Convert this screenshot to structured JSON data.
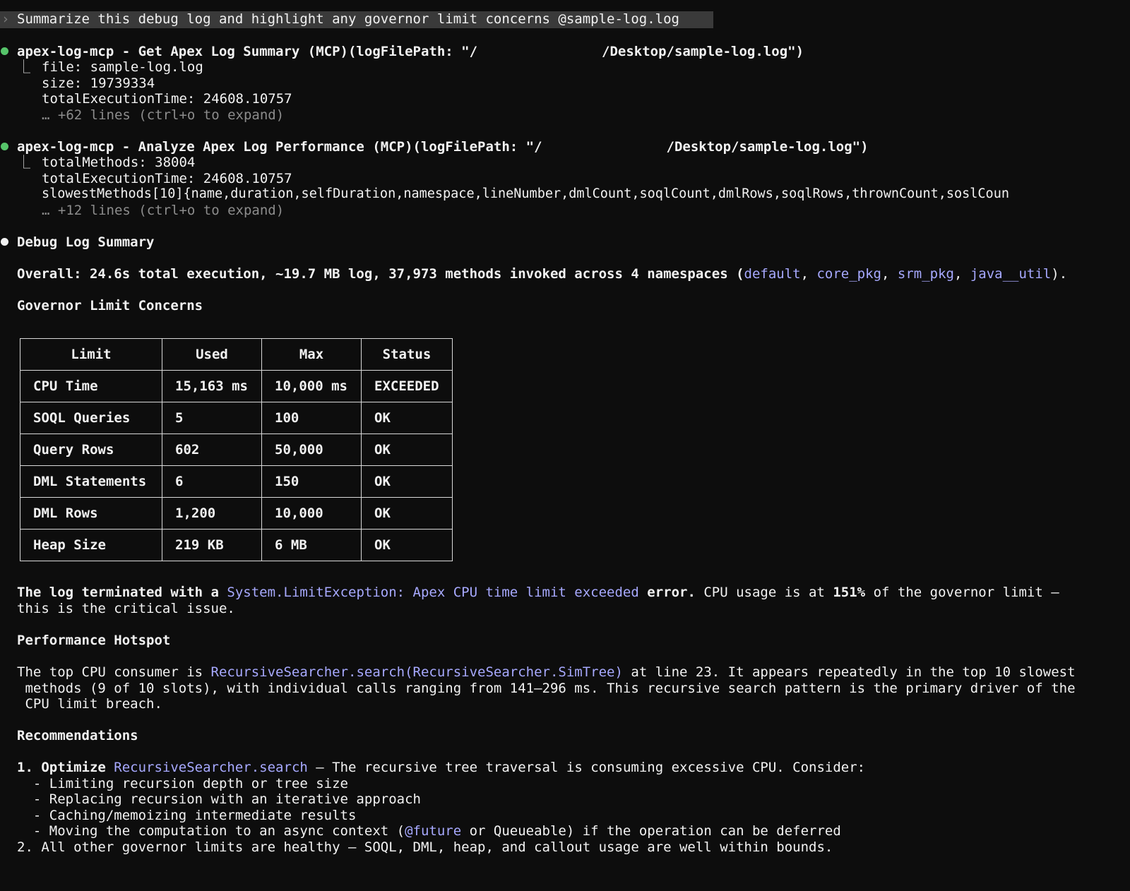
{
  "prompt": {
    "caret": "›",
    "text": "Summarize this debug log and highlight any governor limit concerns @sample-log.log"
  },
  "tool_calls": [
    {
      "header_prefix": "apex-log-mcp - Get Apex Log Summary (MCP)(logFilePath: \"/",
      "header_suffix": "/Desktop/sample-log.log\")",
      "lines": [
        "file: sample-log.log",
        "size: 19739334",
        "totalExecutionTime: 24608.10757"
      ],
      "expand": "… +62 lines (ctrl+o to expand)"
    },
    {
      "header_prefix": "apex-log-mcp - Analyze Apex Log Performance (MCP)(logFilePath: \"/",
      "header_suffix": "/Desktop/sample-log.log\")",
      "lines": [
        "totalMethods: 38004",
        "totalExecutionTime: 24608.10757",
        "slowestMethods[10]{name,duration,selfDuration,namespace,lineNumber,dmlCount,soqlCount,dmlRows,soqlRows,thrownCount,soslCoun"
      ],
      "expand": "… +12 lines (ctrl+o to expand)"
    }
  ],
  "summary": {
    "title": "Debug Log Summary",
    "overall_prefix": "Overall: 24.6s total execution, ~19.7 MB log, 37,973 methods invoked across 4 namespaces (",
    "namespaces": [
      "default",
      "core_pkg",
      "srm_pkg",
      "java__util"
    ],
    "overall_suffix": ").",
    "governor_heading": "Governor Limit Concerns",
    "table": {
      "headers": [
        "Limit",
        "Used",
        "Max",
        "Status"
      ],
      "rows": [
        [
          "CPU Time",
          "15,163 ms",
          "10,000 ms",
          "EXCEEDED"
        ],
        [
          "SOQL Queries",
          "5",
          "100",
          "OK"
        ],
        [
          "Query Rows",
          "602",
          "50,000",
          "OK"
        ],
        [
          "DML Statements",
          "6",
          "150",
          "OK"
        ],
        [
          "DML Rows",
          "1,200",
          "10,000",
          "OK"
        ],
        [
          "Heap Size",
          "219 KB",
          "6 MB",
          "OK"
        ]
      ]
    },
    "terminated_prefix": "The log terminated with a ",
    "terminated_error": "System.LimitException: Apex CPU time limit exceeded",
    "terminated_mid": " error.",
    "terminated_suffix": " CPU usage is at ",
    "terminated_pct": "151%",
    "terminated_end": " of the governor limit —",
    "terminated_line2": "this is the critical issue.",
    "hotspot_heading": "Performance Hotspot",
    "hotspot_prefix": "The top CPU consumer is ",
    "hotspot_method": "RecursiveSearcher.search(RecursiveSearcher.SimTree)",
    "hotspot_suffix": " at line 23. It appears repeatedly in the top 10 slowest",
    "hotspot_line2": " methods (9 of 10 slots), with individual calls ranging from 141–296 ms. This recursive search pattern is the primary driver of the",
    "hotspot_line3": " CPU limit breach.",
    "recommendations_heading": "Recommendations",
    "rec1_prefix": "1. Optimize ",
    "rec1_method": "RecursiveSearcher.search",
    "rec1_suffix": " — The recursive tree traversal is consuming excessive CPU. Consider:",
    "rec1_bullets": [
      "  - Limiting recursion depth or tree size",
      "  - Replacing recursion with an iterative approach",
      "  - Caching/memoizing intermediate results"
    ],
    "rec1_last_prefix": "  - Moving the computation to an async context (",
    "rec1_last_link": "@future",
    "rec1_last_suffix": " or Queueable) if the operation can be deferred",
    "rec2": "2. All other governor limits are healthy — SOQL, DML, heap, and callout usage are well within bounds."
  },
  "colors": {
    "background": "#0d0d0d",
    "text": "#f2f2f2",
    "link": "#a7a9ff",
    "dim": "#8c8c8c",
    "success_dot": "#56c46a"
  }
}
